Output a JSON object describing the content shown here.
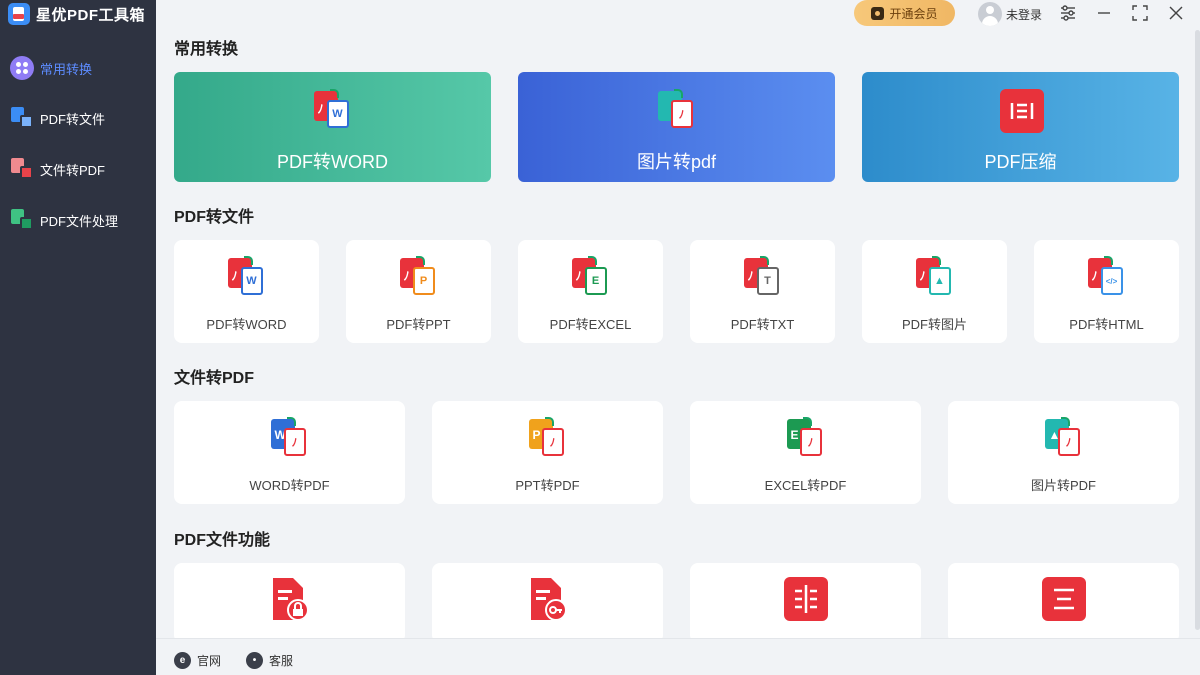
{
  "app": {
    "title": "星优PDF工具箱"
  },
  "sidebar": {
    "items": [
      {
        "label": "常用转换",
        "active": true
      },
      {
        "label": "PDF转文件",
        "active": false
      },
      {
        "label": "文件转PDF",
        "active": false
      },
      {
        "label": "PDF文件处理",
        "active": false
      }
    ]
  },
  "titlebar": {
    "vip_label": "开通会员",
    "user_label": "未登录"
  },
  "sections": {
    "common": {
      "title": "常用转换",
      "cards": [
        {
          "label": "PDF转WORD",
          "icon": "pdf-to-word-icon",
          "color_from": "#34a98a",
          "color_to": "#56c8a8"
        },
        {
          "label": "图片转pdf",
          "icon": "image-to-pdf-icon",
          "color_from": "#3a62d6",
          "color_to": "#5b8ef0"
        },
        {
          "label": "PDF压缩",
          "icon": "pdf-compress-icon",
          "color_from": "#2d8ccb",
          "color_to": "#58b3e6"
        }
      ]
    },
    "pdf_to_file": {
      "title": "PDF转文件",
      "cards": [
        {
          "label": "PDF转WORD",
          "icon": "pdf-to-word-icon",
          "letter": "W",
          "color": "#2f6fd6"
        },
        {
          "label": "PDF转PPT",
          "icon": "pdf-to-ppt-icon",
          "letter": "P",
          "color": "#f08c1c"
        },
        {
          "label": "PDF转EXCEL",
          "icon": "pdf-to-excel-icon",
          "letter": "E",
          "color": "#1c9a52"
        },
        {
          "label": "PDF转TXT",
          "icon": "pdf-to-txt-icon",
          "letter": "T",
          "color": "#666666"
        },
        {
          "label": "PDF转图片",
          "icon": "pdf-to-image-icon",
          "letter": "",
          "color": "#23b8b0"
        },
        {
          "label": "PDF转HTML",
          "icon": "pdf-to-html-icon",
          "letter": "</>",
          "color": "#3a92e8"
        }
      ]
    },
    "file_to_pdf": {
      "title": "文件转PDF",
      "cards": [
        {
          "label": "WORD转PDF",
          "icon": "word-to-pdf-icon",
          "letter": "W",
          "color": "#2f6fd6"
        },
        {
          "label": "PPT转PDF",
          "icon": "ppt-to-pdf-icon",
          "letter": "P",
          "color": "#f0a21c"
        },
        {
          "label": "EXCEL转PDF",
          "icon": "excel-to-pdf-icon",
          "letter": "E",
          "color": "#1c9a52"
        },
        {
          "label": "图片转PDF",
          "icon": "image-to-pdf-icon",
          "letter": "",
          "color": "#23b8b0"
        }
      ]
    },
    "pdf_functions": {
      "title": "PDF文件功能",
      "cards": [
        {
          "icon": "pdf-encrypt-icon"
        },
        {
          "icon": "pdf-decrypt-icon"
        },
        {
          "icon": "pdf-split-icon"
        },
        {
          "icon": "pdf-merge-icon"
        }
      ]
    }
  },
  "footer": {
    "website_label": "官网",
    "service_label": "客服"
  },
  "colors": {
    "sidebar_bg": "#2e3341",
    "accent": "#5d8cff",
    "pdf_red": "#e8323b"
  }
}
